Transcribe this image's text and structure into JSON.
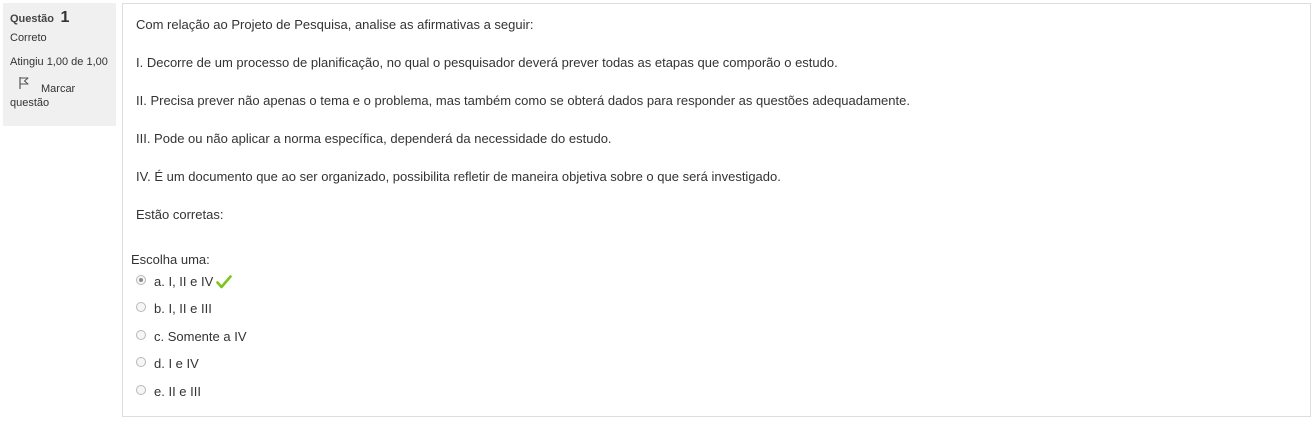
{
  "info": {
    "question_label": "Questão",
    "question_number": "1",
    "state": "Correto",
    "grade": "Atingiu 1,00 de 1,00",
    "flag_label_line1": "Marcar",
    "flag_label_line2": "questão"
  },
  "question": {
    "intro": "Com relação ao Projeto de Pesquisa, analise as afirmativas a seguir:",
    "statements": [
      "I. Decorre de um processo de planificação, no qual o pesquisador deverá prever todas as etapas que comporão o estudo.",
      "II. Precisa prever não apenas o tema e o problema, mas também como se obterá dados para responder as questões adequadamente.",
      "III. Pode ou não aplicar a norma específica, dependerá da necessidade do estudo.",
      "IV. É um documento que ao ser organizado, possibilita refletir de maneira objetiva sobre o que será investigado."
    ],
    "closing": "Estão corretas:",
    "prompt": "Escolha uma:",
    "answers": [
      {
        "label": "a. I, II e IV",
        "selected": true,
        "correct": true
      },
      {
        "label": "b. I, II e III",
        "selected": false
      },
      {
        "label": "c. Somente a IV",
        "selected": false
      },
      {
        "label": "d. I e IV",
        "selected": false
      },
      {
        "label": "e. II e III",
        "selected": false
      }
    ]
  },
  "colors": {
    "info_background": "#f0f0f0",
    "check_green": "#7cc51d",
    "border": "#dedede"
  },
  "icons": {
    "flag": "flag-icon",
    "correct": "check-icon"
  }
}
